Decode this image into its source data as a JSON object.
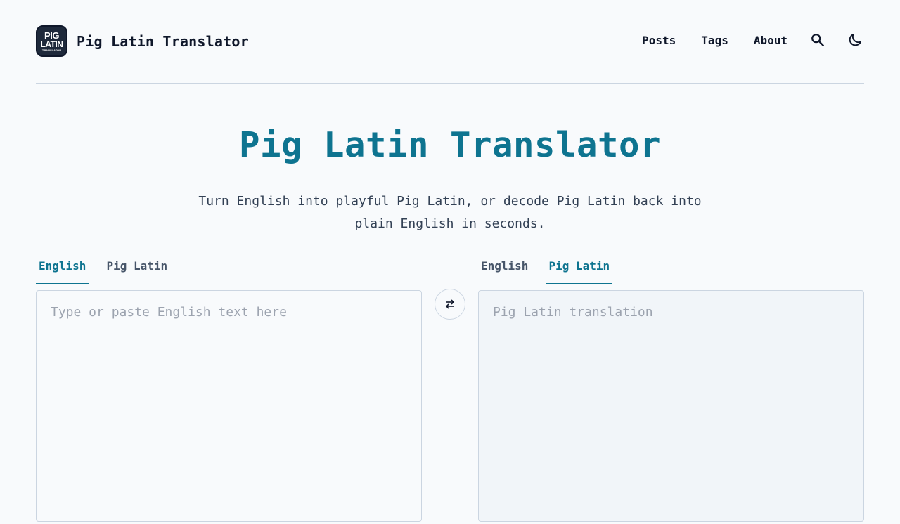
{
  "brand": {
    "logo_line1": "PIG",
    "logo_line2": "LATIN",
    "logo_line3": "TRANSLATOR",
    "title": "Pig Latin Translator"
  },
  "nav": {
    "items": [
      {
        "label": "Posts"
      },
      {
        "label": "Tags"
      },
      {
        "label": "About"
      }
    ],
    "search_icon": "search-icon",
    "theme_icon": "moon-icon"
  },
  "hero": {
    "title": "Pig Latin Translator",
    "subtitle": "Turn English into playful Pig Latin, or decode Pig Latin back into plain English in seconds."
  },
  "source": {
    "tabs": [
      {
        "label": "English",
        "active": true
      },
      {
        "label": "Pig Latin",
        "active": false
      }
    ],
    "value": "",
    "placeholder": "Type or paste English text here"
  },
  "swap": {
    "icon": "swap-arrows-icon"
  },
  "target": {
    "tabs": [
      {
        "label": "English",
        "active": false
      },
      {
        "label": "Pig Latin",
        "active": true
      }
    ],
    "value": "",
    "placeholder": "Pig Latin translation"
  },
  "colors": {
    "accent": "#0e7490",
    "background": "#f8fafc",
    "output_bg": "#f1f5f9",
    "border": "#cbd5e1"
  }
}
